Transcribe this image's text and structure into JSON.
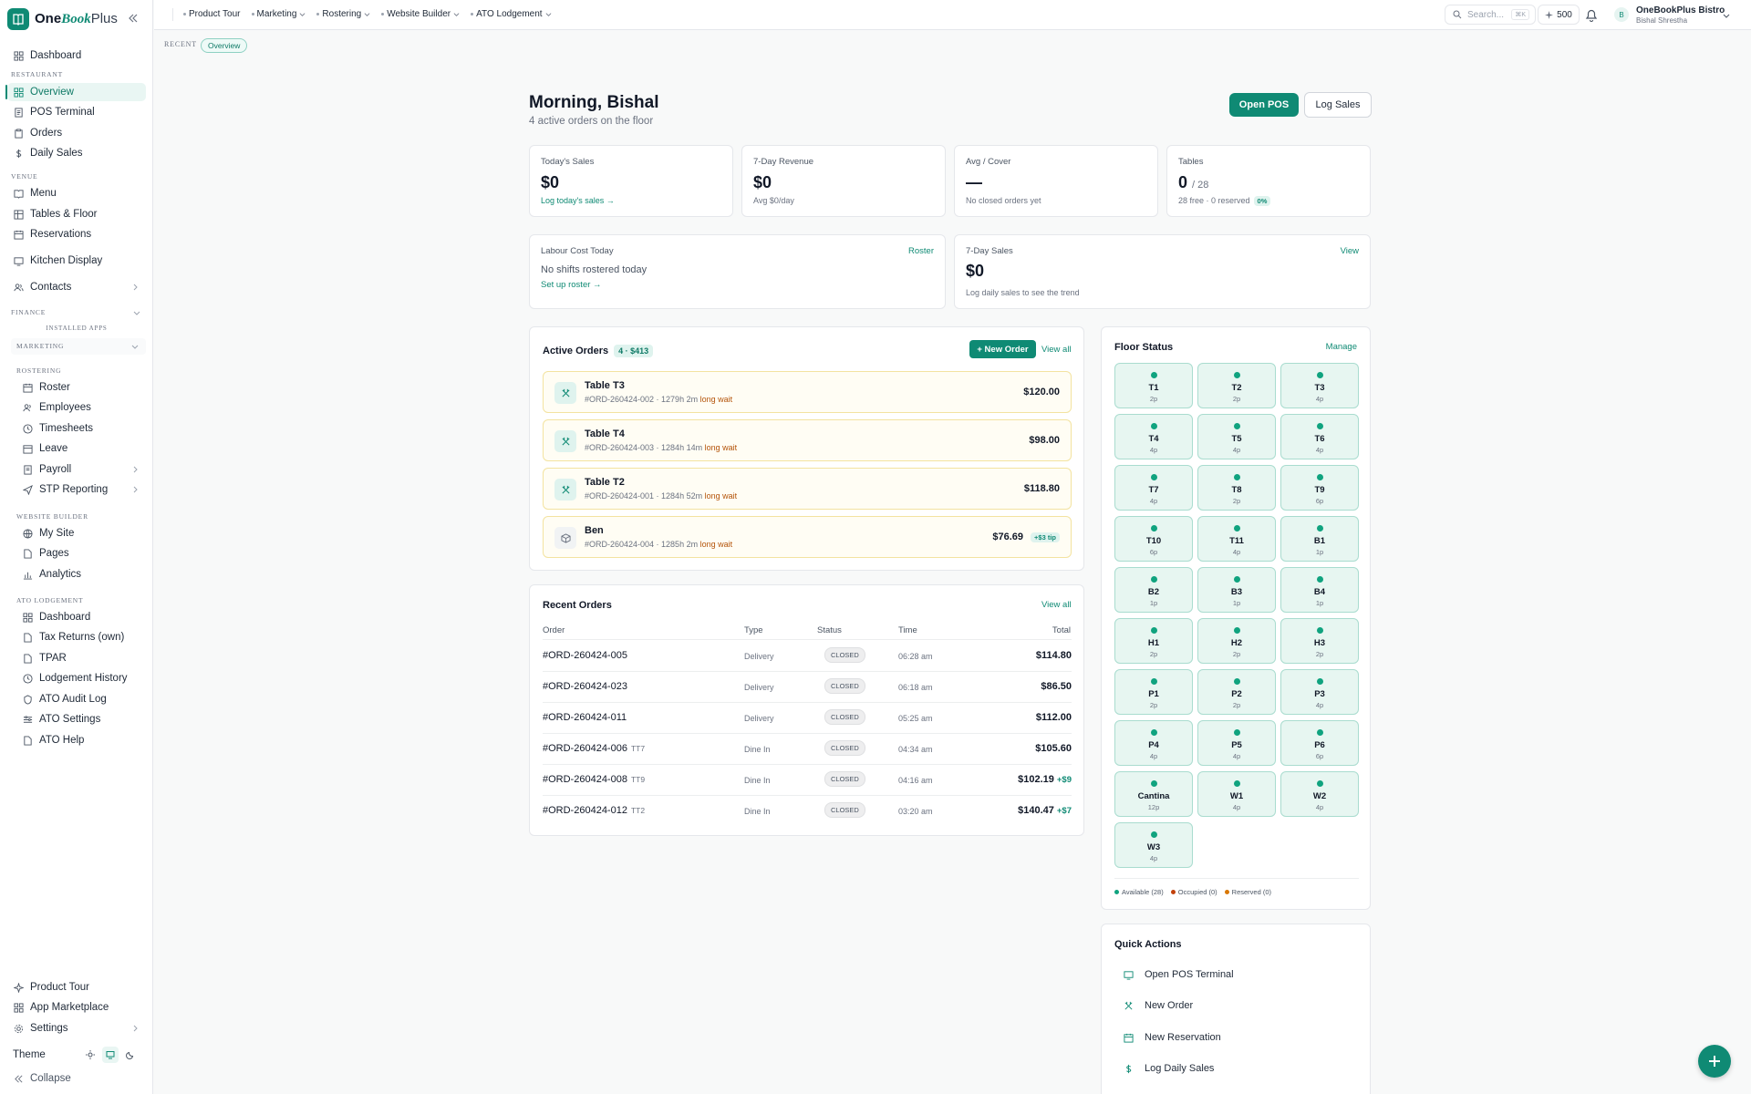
{
  "app": {
    "brand_one": "One",
    "brand_book": "Book",
    "brand_plus": "Plus"
  },
  "colors": {
    "accent": "#0f8a74",
    "available": "#10a37f",
    "occupied": "#c2410c",
    "reserved": "#d97706",
    "long_wait": "#b45309"
  },
  "sidebar": {
    "dashboard": "Dashboard",
    "restaurant_label": "RESTAURANT",
    "restaurant_items": [
      "Overview",
      "POS Terminal",
      "Orders",
      "Daily Sales"
    ],
    "venue_label": "VENUE",
    "venue_items": [
      "Menu",
      "Tables & Floor",
      "Reservations"
    ],
    "kitchen": "Kitchen Display",
    "contacts": "Contacts",
    "finance_label": "FINANCE",
    "installed_label": "INSTALLED APPS",
    "marketing_label": "MARKETING",
    "rostering_label": "ROSTERING",
    "rostering_items": [
      "Roster",
      "Employees",
      "Timesheets",
      "Leave",
      "Payroll",
      "STP Reporting"
    ],
    "website_label": "WEBSITE BUILDER",
    "website_items": [
      "My Site",
      "Pages",
      "Analytics"
    ],
    "ato_label": "ATO LODGEMENT",
    "ato_items": [
      "Dashboard",
      "Tax Returns (own)",
      "TPAR",
      "Lodgement History",
      "ATO Audit Log",
      "ATO Settings",
      "ATO Help"
    ],
    "footer_items": [
      "Product Tour",
      "App Marketplace",
      "Settings"
    ],
    "theme": "Theme",
    "collapse": "Collapse"
  },
  "topbar": {
    "menu": [
      "Product Tour",
      "Marketing",
      "Rostering",
      "Website Builder",
      "ATO Lodgement"
    ],
    "search_placeholder": "Search...",
    "search_kbd": "⌘K",
    "credits": "500",
    "avatar_initial": "B",
    "business": "OneBookPlus Bistro",
    "user": "Bishal Shrestha"
  },
  "breadcrumb": {
    "recent": "RECENT",
    "chip": "Overview"
  },
  "header": {
    "greeting": "Morning, Bishal",
    "subtitle": "4 active orders on the floor",
    "open_pos": "Open POS",
    "log_sales": "Log Sales"
  },
  "stats": {
    "today": {
      "label": "Today's Sales",
      "value": "$0",
      "link": "Log today's sales →"
    },
    "revenue": {
      "label": "7-Day Revenue",
      "value": "$0",
      "sub": "Avg $0/day"
    },
    "cover": {
      "label": "Avg / Cover",
      "value": "—",
      "sub": "No closed orders yet"
    },
    "tables": {
      "label": "Tables",
      "value": "0",
      "total": "/ 28",
      "sub": "28 free · 0 reserved",
      "pct": "0%"
    }
  },
  "labour": {
    "title": "Labour Cost Today",
    "link": "Roster",
    "text": "No shifts rostered today",
    "setup": "Set up roster →"
  },
  "sales7": {
    "title": "7-Day Sales",
    "link": "View",
    "value": "$0",
    "sub": "Log daily sales to see the trend"
  },
  "active_orders": {
    "title": "Active Orders",
    "badge": "4 · $413",
    "new_btn": "+ New Order",
    "view_all": "View all",
    "items": [
      {
        "title": "Table T3",
        "meta": "#ORD-260424-002 · 1279h 2m",
        "wait": "long wait",
        "amount": "$120.00",
        "tip": ""
      },
      {
        "title": "Table T4",
        "meta": "#ORD-260424-003 · 1284h 14m",
        "wait": "long wait",
        "amount": "$98.00",
        "tip": ""
      },
      {
        "title": "Table T2",
        "meta": "#ORD-260424-001 · 1284h 52m",
        "wait": "long wait",
        "amount": "$118.80",
        "tip": ""
      },
      {
        "title": "Ben",
        "meta": "#ORD-260424-004 · 1285h 2m",
        "wait": "long wait",
        "amount": "$76.69",
        "tip": "+$3 tip"
      }
    ]
  },
  "recent_orders": {
    "title": "Recent Orders",
    "view_all": "View all",
    "headers": [
      "Order",
      "Type",
      "Status",
      "Time",
      "Total"
    ],
    "rows": [
      {
        "order": "#ORD-260424-005",
        "table": "",
        "type": "Delivery",
        "status": "CLOSED",
        "time": "06:28 am",
        "total": "$114.80",
        "tip": ""
      },
      {
        "order": "#ORD-260424-023",
        "table": "",
        "type": "Delivery",
        "status": "CLOSED",
        "time": "06:18 am",
        "total": "$86.50",
        "tip": ""
      },
      {
        "order": "#ORD-260424-011",
        "table": "",
        "type": "Delivery",
        "status": "CLOSED",
        "time": "05:25 am",
        "total": "$112.00",
        "tip": ""
      },
      {
        "order": "#ORD-260424-006",
        "table": "TT7",
        "type": "Dine In",
        "status": "CLOSED",
        "time": "04:34 am",
        "total": "$105.60",
        "tip": ""
      },
      {
        "order": "#ORD-260424-008",
        "table": "TT9",
        "type": "Dine In",
        "status": "CLOSED",
        "time": "04:16 am",
        "total": "$102.19",
        "tip": "+$9"
      },
      {
        "order": "#ORD-260424-012",
        "table": "TT2",
        "type": "Dine In",
        "status": "CLOSED",
        "time": "03:20 am",
        "total": "$140.47",
        "tip": "+$7"
      }
    ]
  },
  "floor": {
    "title": "Floor Status",
    "manage": "Manage",
    "tables": [
      {
        "name": "T1",
        "cap": "2p"
      },
      {
        "name": "T2",
        "cap": "2p"
      },
      {
        "name": "T3",
        "cap": "4p"
      },
      {
        "name": "T4",
        "cap": "4p"
      },
      {
        "name": "T5",
        "cap": "4p"
      },
      {
        "name": "T6",
        "cap": "4p"
      },
      {
        "name": "T7",
        "cap": "4p"
      },
      {
        "name": "T8",
        "cap": "2p"
      },
      {
        "name": "T9",
        "cap": "6p"
      },
      {
        "name": "T10",
        "cap": "6p"
      },
      {
        "name": "T11",
        "cap": "4p"
      },
      {
        "name": "B1",
        "cap": "1p"
      },
      {
        "name": "B2",
        "cap": "1p"
      },
      {
        "name": "B3",
        "cap": "1p"
      },
      {
        "name": "B4",
        "cap": "1p"
      },
      {
        "name": "H1",
        "cap": "2p"
      },
      {
        "name": "H2",
        "cap": "2p"
      },
      {
        "name": "H3",
        "cap": "2p"
      },
      {
        "name": "P1",
        "cap": "2p"
      },
      {
        "name": "P2",
        "cap": "2p"
      },
      {
        "name": "P3",
        "cap": "4p"
      },
      {
        "name": "P4",
        "cap": "4p"
      },
      {
        "name": "P5",
        "cap": "4p"
      },
      {
        "name": "P6",
        "cap": "6p"
      },
      {
        "name": "Cantina",
        "cap": "12p"
      },
      {
        "name": "W1",
        "cap": "4p"
      },
      {
        "name": "W2",
        "cap": "4p"
      },
      {
        "name": "W3",
        "cap": "4p"
      }
    ],
    "legend": [
      "Available (28)",
      "Occupied (0)",
      "Reserved (0)"
    ]
  },
  "quick_actions": {
    "title": "Quick Actions",
    "items": [
      "Open POS Terminal",
      "New Order",
      "New Reservation",
      "Log Daily Sales"
    ]
  }
}
